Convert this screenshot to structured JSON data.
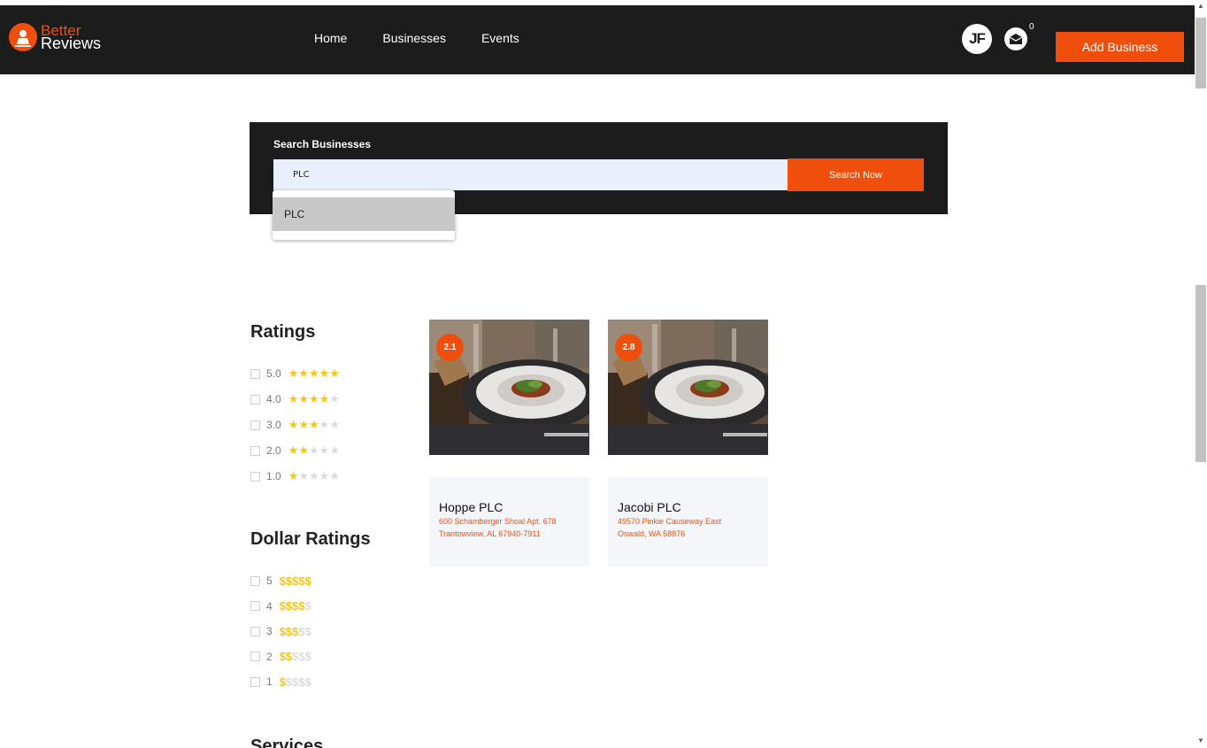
{
  "header": {
    "logo_line1": "Better",
    "logo_line2": "Reviews",
    "nav": [
      "Home",
      "Businesses",
      "Events"
    ],
    "avatar_initials": "JF",
    "mail_count": "0",
    "add_business": "Add Business",
    "colors": {
      "bar": "#1c1c1c",
      "accent": "#f04e0c"
    }
  },
  "search": {
    "title": "Search Businesses",
    "value": "PLC",
    "button": "Search Now",
    "suggestion": "PLC"
  },
  "filters": {
    "ratings_title": "Ratings",
    "ratings": [
      {
        "label": "5.0",
        "stars": 5
      },
      {
        "label": "4.0",
        "stars": 4
      },
      {
        "label": "3.0",
        "stars": 3
      },
      {
        "label": "2.0",
        "stars": 2
      },
      {
        "label": "1.0",
        "stars": 1
      }
    ],
    "dollar_title": "Dollar Ratings",
    "dollars": [
      {
        "label": "5",
        "level": 5
      },
      {
        "label": "4",
        "level": 4
      },
      {
        "label": "3",
        "level": 3
      },
      {
        "label": "2",
        "level": 2
      },
      {
        "label": "1",
        "level": 1
      }
    ],
    "services_title": "Services"
  },
  "businesses": [
    {
      "rating": "2.1",
      "name": "Hoppe PLC",
      "address1": "600 Schamberger Shoal Apt. 678",
      "address2": "Trantowview, AL 67940-7911"
    },
    {
      "rating": "2.8",
      "name": "Jacobi PLC",
      "address1": "49570 Pinkie Causeway East",
      "address2": "Oswald, WA 58876"
    }
  ]
}
